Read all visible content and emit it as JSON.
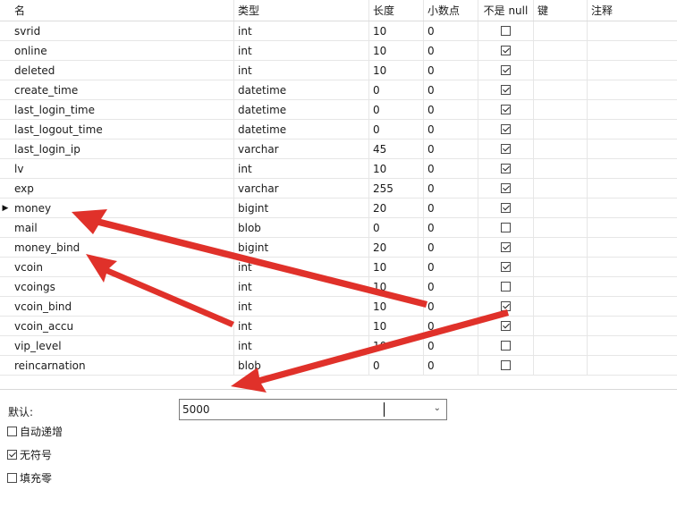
{
  "columns": [
    "名",
    "类型",
    "长度",
    "小数点",
    "不是 null",
    "键",
    "注释"
  ],
  "rows": [
    {
      "name": "svrid",
      "type": "int",
      "length": "10",
      "decimals": "0",
      "not_null": false
    },
    {
      "name": "online",
      "type": "int",
      "length": "10",
      "decimals": "0",
      "not_null": true
    },
    {
      "name": "deleted",
      "type": "int",
      "length": "10",
      "decimals": "0",
      "not_null": true
    },
    {
      "name": "create_time",
      "type": "datetime",
      "length": "0",
      "decimals": "0",
      "not_null": true
    },
    {
      "name": "last_login_time",
      "type": "datetime",
      "length": "0",
      "decimals": "0",
      "not_null": true
    },
    {
      "name": "last_logout_time",
      "type": "datetime",
      "length": "0",
      "decimals": "0",
      "not_null": true
    },
    {
      "name": "last_login_ip",
      "type": "varchar",
      "length": "45",
      "decimals": "0",
      "not_null": true
    },
    {
      "name": "lv",
      "type": "int",
      "length": "10",
      "decimals": "0",
      "not_null": true
    },
    {
      "name": "exp",
      "type": "varchar",
      "length": "255",
      "decimals": "0",
      "not_null": true
    },
    {
      "name": "money",
      "type": "bigint",
      "length": "20",
      "decimals": "0",
      "not_null": true,
      "current": true
    },
    {
      "name": "mail",
      "type": "blob",
      "length": "0",
      "decimals": "0",
      "not_null": false
    },
    {
      "name": "money_bind",
      "type": "bigint",
      "length": "20",
      "decimals": "0",
      "not_null": true
    },
    {
      "name": "vcoin",
      "type": "int",
      "length": "10",
      "decimals": "0",
      "not_null": true
    },
    {
      "name": "vcoings",
      "type": "int",
      "length": "10",
      "decimals": "0",
      "not_null": false
    },
    {
      "name": "vcoin_bind",
      "type": "int",
      "length": "10",
      "decimals": "0",
      "not_null": true
    },
    {
      "name": "vcoin_accu",
      "type": "int",
      "length": "10",
      "decimals": "0",
      "not_null": true
    },
    {
      "name": "vip_level",
      "type": "int",
      "length": "10",
      "decimals": "0",
      "not_null": false
    },
    {
      "name": "reincarnation",
      "type": "blob",
      "length": "0",
      "decimals": "0",
      "not_null": false
    }
  ],
  "row_marker": "▶",
  "default_label": "默认:",
  "default_value": "5000",
  "dropdown_icon": "chevron-down",
  "options": [
    {
      "label": "自动递增",
      "checked": false
    },
    {
      "label": "无符号",
      "checked": true
    },
    {
      "label": "填充零",
      "checked": false
    }
  ],
  "annotation_color": "#e0312a"
}
